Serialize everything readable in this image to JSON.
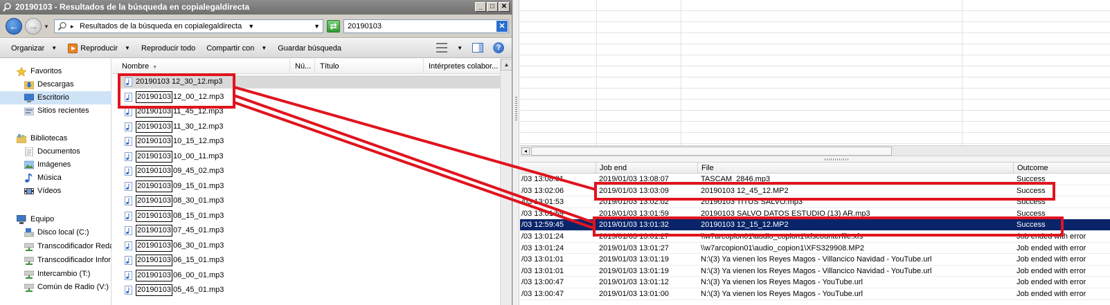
{
  "window": {
    "title": "20190103 - Resultados de la búsqueda en copialegaldirecta",
    "minimize": "_",
    "maximize": "□",
    "close": "✕"
  },
  "address": {
    "path": "Resultados de la búsqueda en copialegaldirecta",
    "search_value": "20190103"
  },
  "toolbar": {
    "organize": "Organizar",
    "play": "Reproducir",
    "play_all": "Reproducir todo",
    "share": "Compartir con",
    "save_search": "Guardar búsqueda"
  },
  "nav": {
    "favorites": "Favoritos",
    "downloads": "Descargas",
    "desktop": "Escritorio",
    "recent": "Sitios recientes",
    "libraries": "Bibliotecas",
    "documents": "Documentos",
    "images": "Imágenes",
    "music": "Música",
    "videos": "Vídeos",
    "computer": "Equipo",
    "disk_c": "Disco local (C:)",
    "transcoder_red": "Transcodificador Reda",
    "transcoder_info": "Transcodificador Infor",
    "intercambio": "Intercambio (T:)",
    "comun_radio": "Común de Radio (V:)"
  },
  "columns": {
    "name": "Nombre",
    "number": "Nú...",
    "title": "Título",
    "artists": "Intérpretes colabor..."
  },
  "files": [
    {
      "prefix": "20190103",
      "rest": " 12_30_12.mp3",
      "highlight": false
    },
    {
      "prefix": "20190103",
      "rest": "12_00_12.mp3",
      "highlight": true
    },
    {
      "prefix": "20190103",
      "rest": "11_45_12.mp3",
      "highlight": true
    },
    {
      "prefix": "20190103",
      "rest": "11_30_12.mp3",
      "highlight": true
    },
    {
      "prefix": "20190103",
      "rest": "10_15_12.mp3",
      "highlight": true
    },
    {
      "prefix": "20190103",
      "rest": "10_00_11.mp3",
      "highlight": true
    },
    {
      "prefix": "20190103",
      "rest": "09_45_02.mp3",
      "highlight": true
    },
    {
      "prefix": "20190103",
      "rest": "09_15_01.mp3",
      "highlight": true
    },
    {
      "prefix": "20190103",
      "rest": "08_30_01.mp3",
      "highlight": true
    },
    {
      "prefix": "20190103",
      "rest": "08_15_01.mp3",
      "highlight": true
    },
    {
      "prefix": "20190103",
      "rest": "07_45_01.mp3",
      "highlight": true
    },
    {
      "prefix": "20190103",
      "rest": "06_30_01.mp3",
      "highlight": true
    },
    {
      "prefix": "20190103",
      "rest": "06_15_01.mp3",
      "highlight": true
    },
    {
      "prefix": "20190103",
      "rest": "06_00_01.mp3",
      "highlight": true
    },
    {
      "prefix": "20190103",
      "rest": "05_45_01.mp3",
      "highlight": true
    }
  ],
  "jobs": {
    "headers": [
      "",
      "Job end",
      "File",
      "Outcome"
    ],
    "rows": [
      [
        "/03 13:08:01",
        "2019/01/03 13:08:07",
        "TASCAM_2846.mp3",
        "Success"
      ],
      [
        "/03 13:02:06",
        "2019/01/03 13:03:09",
        "20190103 12_45_12.MP2",
        "Success"
      ],
      [
        "/03 13:01:53",
        "2019/01/03 13:02:02",
        "20190103 TITUS SALVO.mp3",
        "Success"
      ],
      [
        "/03 13:01:59",
        "2019/01/03 13:01:59",
        "20190103 SALVO DATOS ESTUDIO (13) AR.mp3",
        "Success"
      ],
      [
        "/03 12:59:45",
        "2019/01/03 13:01:32",
        "20190103 12_15_12.MP2",
        "Success"
      ],
      [
        "/03 13:01:24",
        "2019/01/03 13:01:27",
        "\\\\w7arcopion01\\audio_copion1\\xfscounterfile.xfs",
        "Job ended with error"
      ],
      [
        "/03 13:01:24",
        "2019/01/03 13:01:27",
        "\\\\w7arcopion01\\audio_copion1\\XFS329908.MP2",
        "Job ended with error"
      ],
      [
        "/03 13:01:01",
        "2019/01/03 13:01:19",
        "N:\\(3) Ya vienen los Reyes Magos - Villancico Navidad - YouTube.url",
        "Job ended with error"
      ],
      [
        "/03 13:01:01",
        "2019/01/03 13:01:19",
        "N:\\(3) Ya vienen los Reyes Magos - Villancico Navidad - YouTube.url",
        "Job ended with error"
      ],
      [
        "/03 13:00:47",
        "2019/01/03 13:01:12",
        "N:\\(3) Ya vienen los Reyes Magos - YouTube.url",
        "Job ended with error"
      ],
      [
        "/03 13:00:47",
        "2019/01/03 13:01:00",
        "N:\\(3) Ya vienen los Reyes Magos - YouTube.url",
        "Job ended with error"
      ]
    ],
    "selected_index": 4
  },
  "colors": {
    "annotation": "#e0141e",
    "selection": "#0a246a"
  }
}
